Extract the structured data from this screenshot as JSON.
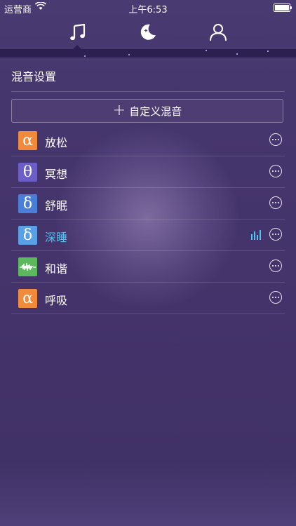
{
  "status_bar": {
    "carrier": "运营商",
    "time": "上午6:53"
  },
  "top_nav": {
    "tabs": [
      {
        "name": "music",
        "icon": "music-note-icon",
        "active": true
      },
      {
        "name": "sleep",
        "icon": "moon-icon",
        "active": false
      },
      {
        "name": "profile",
        "icon": "person-icon",
        "active": false
      }
    ]
  },
  "main": {
    "title": "混音设置",
    "custom_button": "自定义混音",
    "items": [
      {
        "symbol": "α",
        "label": "放松",
        "color": "#f28a3c",
        "active": false
      },
      {
        "symbol": "θ",
        "label": "冥想",
        "color": "#6b5fc7",
        "active": false
      },
      {
        "symbol": "δ",
        "label": "舒眠",
        "color": "#4a7fd8",
        "active": false
      },
      {
        "symbol": "δ",
        "label": "深睡",
        "color": "#5aa0e6",
        "active": true
      },
      {
        "symbol": "waveform",
        "label": "和谐",
        "color": "#5cb85c",
        "active": false
      },
      {
        "symbol": "α",
        "label": "呼吸",
        "color": "#f28a3c",
        "active": false
      }
    ]
  },
  "colors": {
    "background": "#46366e",
    "accent": "#4fc3f0"
  }
}
